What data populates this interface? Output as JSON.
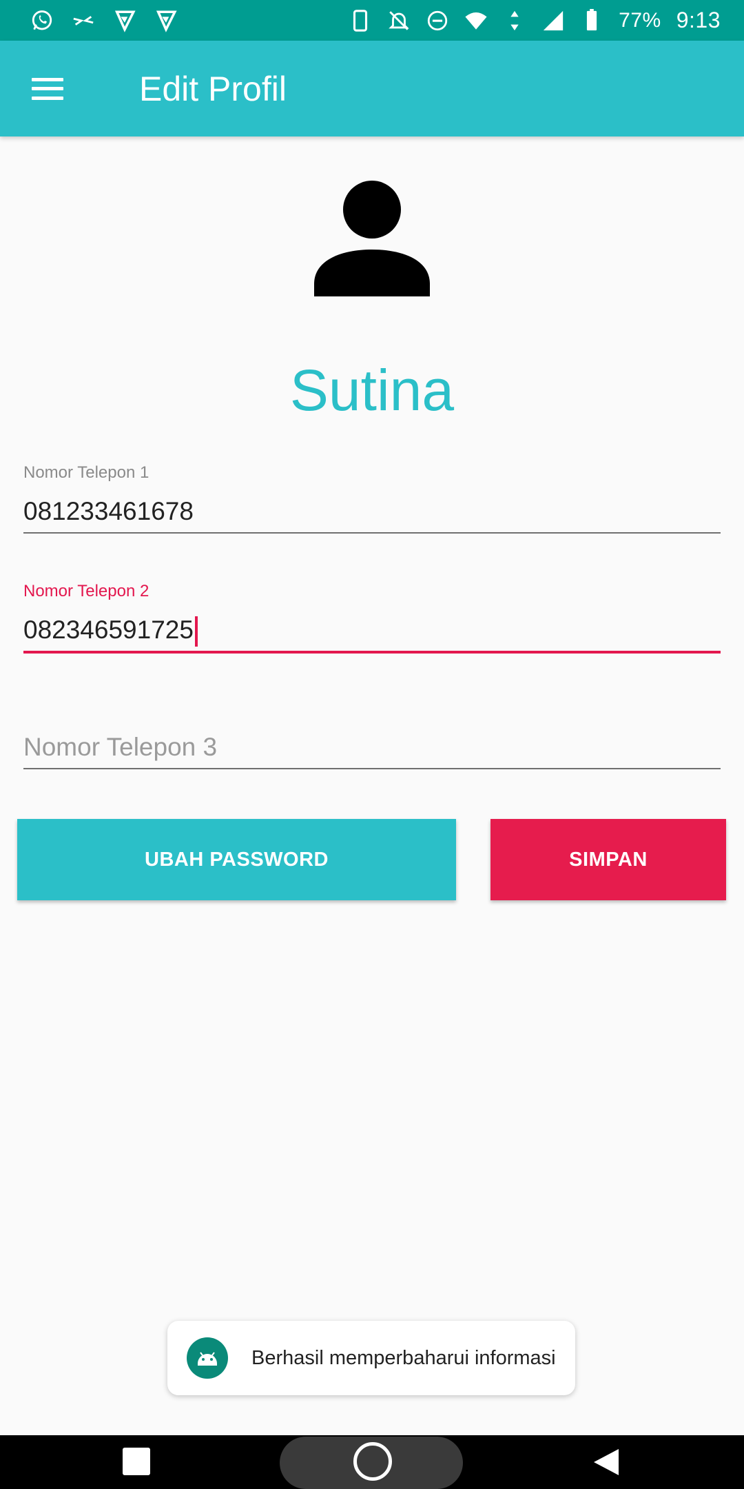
{
  "status_bar": {
    "left_icons": [
      "whatsapp-icon",
      "compress-arrows-icon",
      "play-store-icon",
      "play-store-icon"
    ],
    "right_icons": [
      "phone-icon",
      "notifications-off-icon",
      "do-not-disturb-icon",
      "wifi-icon",
      "data-arrows-icon",
      "signal-icon",
      "battery-icon"
    ],
    "battery": "77%",
    "time": "9:13"
  },
  "app_bar": {
    "menu_icon": "hamburger-menu-icon",
    "title": "Edit Profil"
  },
  "profile": {
    "avatar_icon": "person-icon",
    "name": "Sutina"
  },
  "fields": {
    "phone1": {
      "label": "Nomor Telepon 1",
      "value": "081233461678"
    },
    "phone2": {
      "label": "Nomor Telepon 2",
      "value": "082346591725"
    },
    "phone3": {
      "placeholder": "Nomor Telepon 3"
    }
  },
  "buttons": {
    "change_password": "UBAH PASSWORD",
    "save": "SIMPAN"
  },
  "toast": {
    "icon": "android-icon",
    "message": "Berhasil memperbaharui informasi"
  },
  "colors": {
    "status_bar": "#009d91",
    "primary": "#2bbfc8",
    "accent": "#e61c4d",
    "background": "#fafafa"
  }
}
